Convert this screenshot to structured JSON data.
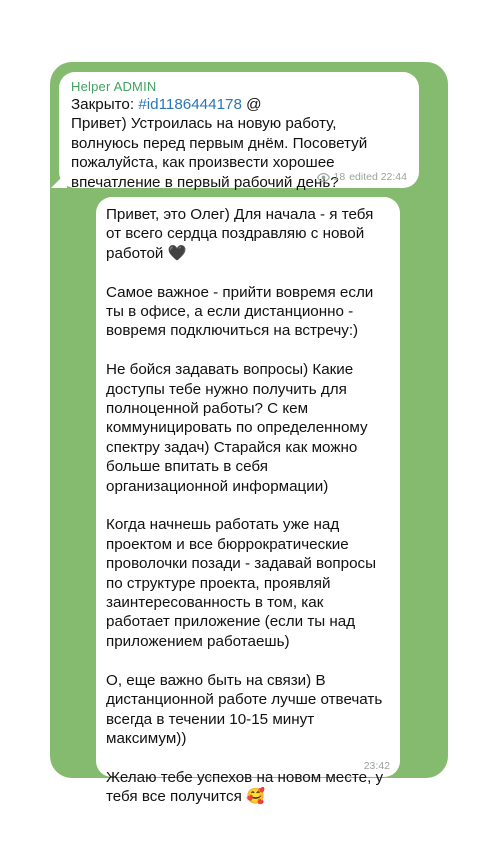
{
  "colors": {
    "chat_background": "#84bb6f",
    "bubble": "#ffffff",
    "sender_name": "#41a35f",
    "hashtag": "#2a76b8",
    "meta_text": "#9aa39a"
  },
  "question_message": {
    "sender": "Helper ADMIN",
    "closed_prefix": "Закрыто: ",
    "hashtag": "#id1186444178",
    "at_symbol": " @",
    "body": "Привет) Устроилась на новую работу, волнуюсь перед первым днём. Посоветуй пожалуйста, как произвести хорошее впечатление в первый рабочий день?",
    "views_icon": "eye-icon",
    "views": "18",
    "edited_time": "edited 22:44"
  },
  "answer_message": {
    "paragraphs": [
      "Привет, это Олег) Для начала - я тебя от всего сердца поздравляю с новой работой 🖤",
      "Самое важное - прийти вовремя если ты в офисе, а если дистанционно - вовремя подключиться на встречу:)",
      "Не бойся задавать вопросы) Какие доступы тебе нужно получить для полноценной работы? С кем коммуницировать по определенному спектру задач) Старайся как можно больше впитать в себя организационной информации)",
      "Когда начнешь работать уже над проектом и все бюррократические проволочки позади - задавай вопросы по структуре проекта, проявляй заинтересованность в том, как работает приложение (если ты над приложением работаешь)",
      "О, еще важно быть на связи) В дистанционной работе лучше отвечать всегда в течении 10-15 минут максимум))",
      "Желаю тебе успехов на новом месте, у тебя все получится 🥰"
    ],
    "time": "23:42"
  }
}
